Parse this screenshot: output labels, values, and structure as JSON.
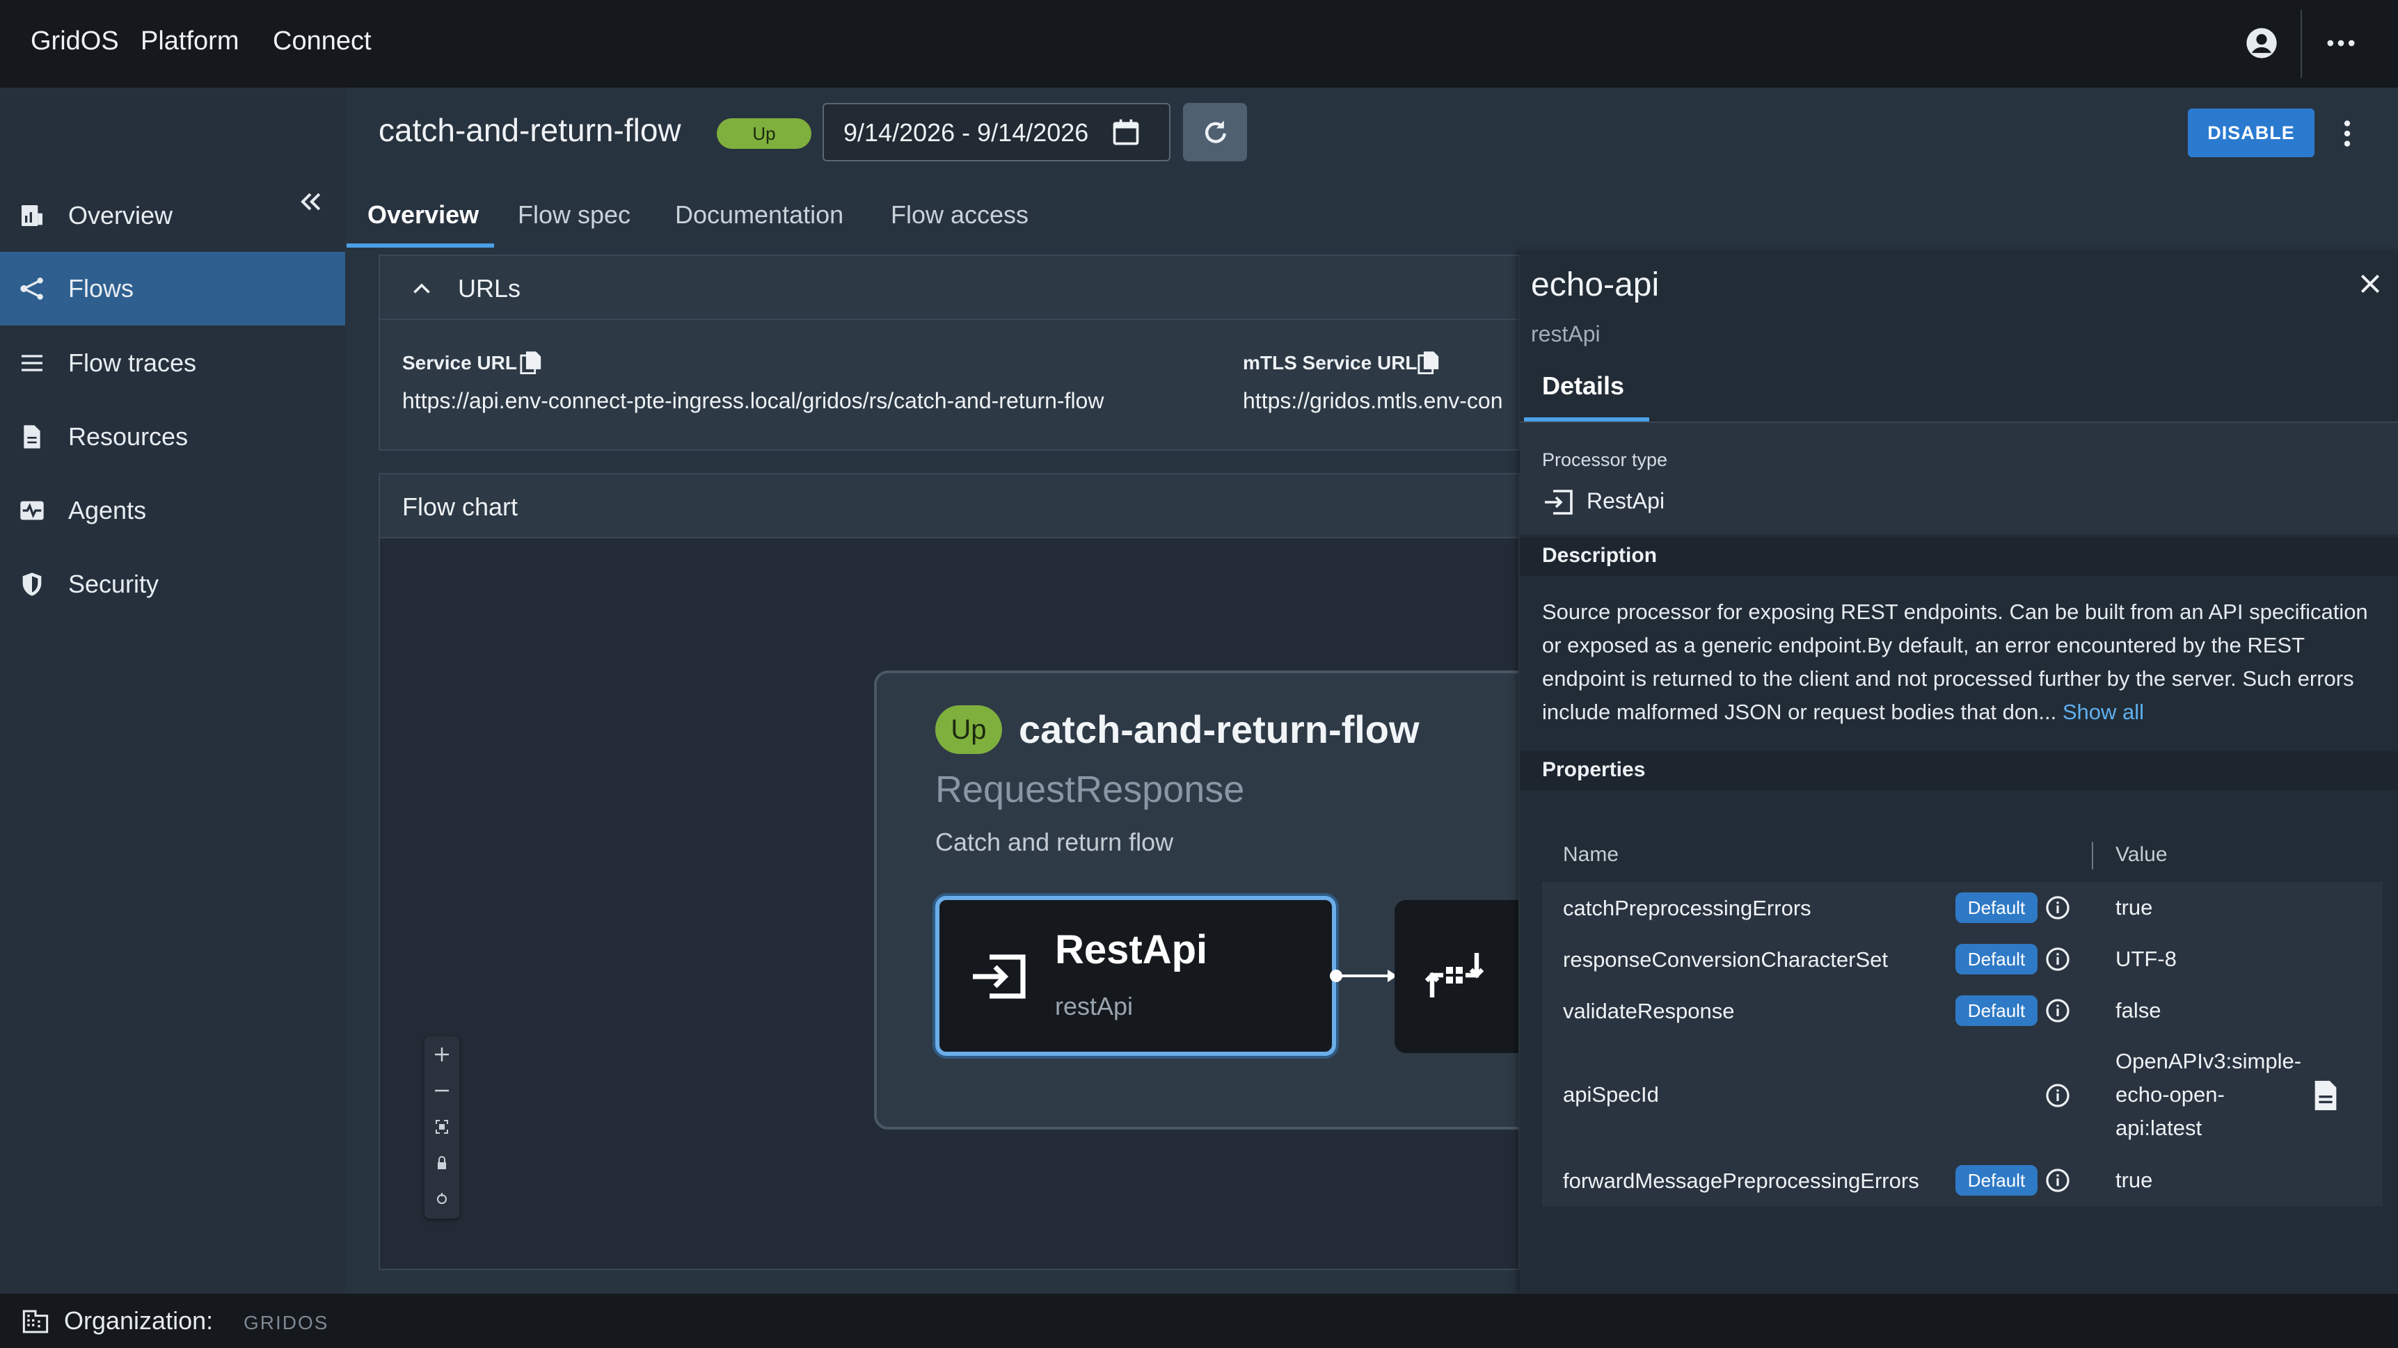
{
  "topbar": {
    "brand": "GridOS",
    "product": "Platform",
    "module": "Connect",
    "icons": [
      "account-circle-icon",
      "more-horizontal-icon"
    ]
  },
  "sidebar": {
    "items": [
      {
        "label": "Overview",
        "icon": "dashboard-icon",
        "active": false
      },
      {
        "label": "Flows",
        "icon": "flows-icon",
        "active": true
      },
      {
        "label": "Flow traces",
        "icon": "list-icon",
        "active": false
      },
      {
        "label": "Resources",
        "icon": "document-icon",
        "active": false
      },
      {
        "label": "Agents",
        "icon": "monitor-heart-icon",
        "active": false
      },
      {
        "label": "Security",
        "icon": "shield-icon",
        "active": false
      }
    ]
  },
  "header": {
    "title": "catch-and-return-flow",
    "status": "Up",
    "date_range": "9/14/2026 - 9/14/2026",
    "disable_label": "DISABLE"
  },
  "tabs": [
    {
      "label": "Overview",
      "active": true
    },
    {
      "label": "Flow spec",
      "active": false
    },
    {
      "label": "Documentation",
      "active": false
    },
    {
      "label": "Flow access",
      "active": false
    }
  ],
  "urls": {
    "section_label": "URLs",
    "service_url_label": "Service URL",
    "service_url": "https://api.env-connect-pte-ingress.local/gridos/rs/catch-and-return-flow",
    "mtls_url_label": "mTLS Service URL",
    "mtls_url": "https://gridos.mtls.env-con"
  },
  "flow_chart": {
    "section_label": "Flow chart",
    "card": {
      "status": "Up",
      "title": "catch-and-return-flow",
      "type": "RequestResponse",
      "description": "Catch and return flow"
    },
    "node": {
      "name": "RestApi",
      "sub": "restApi"
    }
  },
  "detail": {
    "title": "echo-api",
    "subtitle": "restApi",
    "tab": "Details",
    "processor_type_label": "Processor type",
    "processor_type": "RestApi",
    "description_label": "Description",
    "description": "Source processor for exposing REST endpoints. Can be built from an API specification or exposed as a generic endpoint.By default, an error encountered by the REST endpoint is returned to the client and not processed further by the server. Such errors include malformed JSON or request bodies that don...",
    "show_all": "Show all",
    "properties_label": "Properties",
    "col_name": "Name",
    "col_value": "Value",
    "properties": [
      {
        "name": "catchPreprocessingErrors",
        "badge": "Default",
        "value": "true"
      },
      {
        "name": "responseConversionCharacterSet",
        "badge": "Default",
        "value": "UTF-8"
      },
      {
        "name": "validateResponse",
        "badge": "Default",
        "value": "false"
      },
      {
        "name": "apiSpecId",
        "badge": "",
        "value": "OpenAPIv3:simple-echo-open-api:latest"
      },
      {
        "name": "forwardMessagePreprocessingErrors",
        "badge": "Default",
        "value": "true"
      }
    ]
  },
  "footer": {
    "label": "Organization:",
    "org": "GRIDOS"
  },
  "colors": {
    "accent": "#2a7ad0",
    "status_up": "#7fb03d",
    "active_nav": "#2e5f8f"
  }
}
